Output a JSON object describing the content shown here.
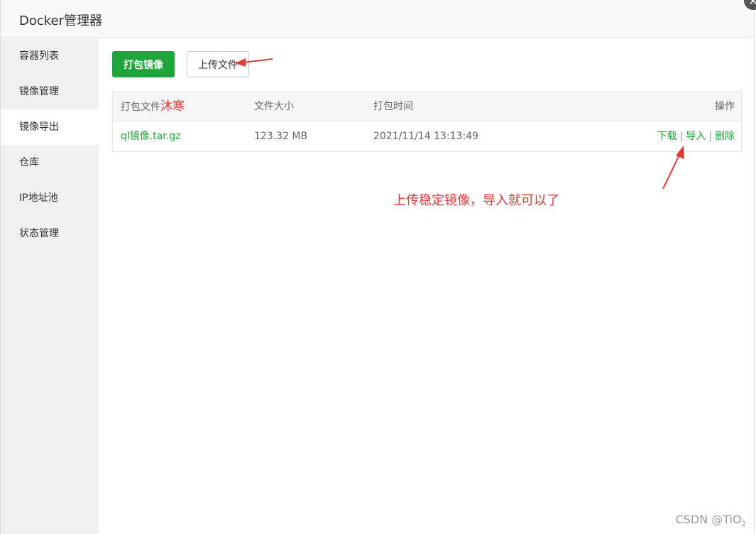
{
  "window": {
    "title": "Docker管理器"
  },
  "sidebar": {
    "items": [
      {
        "label": "容器列表",
        "active": false
      },
      {
        "label": "镜像管理",
        "active": false
      },
      {
        "label": "镜像导出",
        "active": true
      },
      {
        "label": "仓库",
        "active": false
      },
      {
        "label": "IP地址池",
        "active": false
      },
      {
        "label": "状态管理",
        "active": false
      }
    ]
  },
  "toolbar": {
    "pack_label": "打包镜像",
    "upload_label": "上传文件"
  },
  "table": {
    "headers": [
      "打包文件",
      "文件大小",
      "打包时间",
      "操作"
    ],
    "header_annotation": "沐寒",
    "rows": [
      {
        "file": "ql镜像.tar.gz",
        "size": "123.32 MB",
        "time": "2021/11/14 13:13:49",
        "actions": [
          "下载",
          "导入",
          "删除"
        ]
      }
    ]
  },
  "annotation": "上传稳定镜像，导入就可以了",
  "watermark": {
    "text": "CSDN @TiO",
    "sub": "2"
  },
  "colors": {
    "accent": "#20a53a",
    "annotation": "#e53935"
  }
}
